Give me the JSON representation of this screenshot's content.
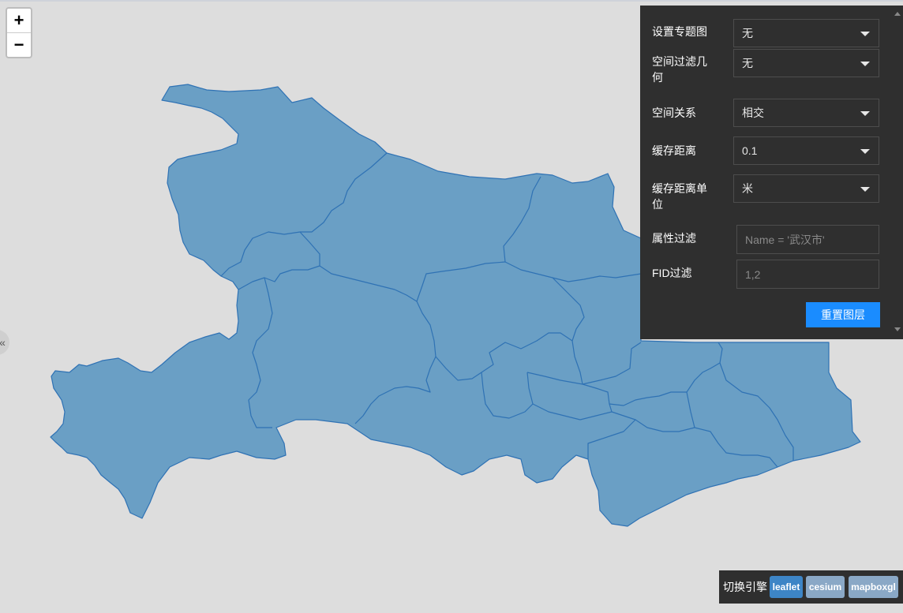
{
  "map": {
    "zoom_in_label": "+",
    "zoom_out_label": "−",
    "region_fill": "#6a9fc5",
    "region_stroke": "#2f72b4",
    "background": "#dddddd",
    "collapse_icon": "«"
  },
  "panel": {
    "rows": [
      {
        "label": "设置专题图",
        "value": "无"
      },
      {
        "label": "空间过滤几何",
        "value": "无"
      },
      {
        "label": "空间关系",
        "value": "相交"
      },
      {
        "label": "缓存距离",
        "value": "0.1"
      },
      {
        "label": "缓存距离单位",
        "value": "米"
      }
    ],
    "attr_filter": {
      "label": "属性过滤",
      "placeholder": "Name = '武汉市'"
    },
    "fid_filter": {
      "label": "FID过滤",
      "placeholder": "1,2"
    },
    "reset_label": "重置图层"
  },
  "engine": {
    "label": "切换引擎",
    "options": [
      {
        "label": "leaflet",
        "active": true
      },
      {
        "label": "cesium",
        "active": false
      },
      {
        "label": "mapboxgl",
        "active": false
      }
    ]
  }
}
